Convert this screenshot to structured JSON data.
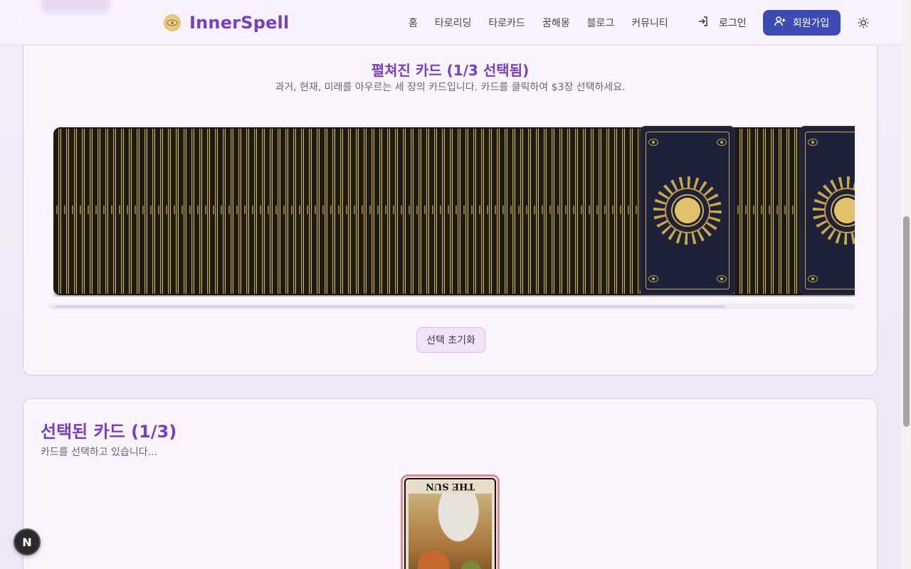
{
  "header": {
    "brand": "InnerSpell",
    "nav": [
      "홈",
      "타로리딩",
      "타로카드",
      "꿈해몽",
      "블로그",
      "커뮤니티"
    ],
    "login_label": "로그인",
    "signup_label": "회원가입",
    "theme_icon": "sun-icon",
    "accent_color": "#7a3fc0",
    "button_color": "#3d4cb5"
  },
  "spread": {
    "title": "펼쳐진 카드 (1/3 선택됨)",
    "subtitle": "과거, 현재, 미래를 아우르는 세 장의 카드입니다. 카드를 클릭하여 $3장 선택하세요.",
    "reset_label": "선택 초기화"
  },
  "selected": {
    "title": "선택된 카드 (1/3)",
    "subtitle": "카드를 선택하고 있습니다...",
    "cards": [
      {
        "name": "THE SUN",
        "orientation": "reversed"
      }
    ]
  },
  "fab": {
    "label": "N"
  }
}
